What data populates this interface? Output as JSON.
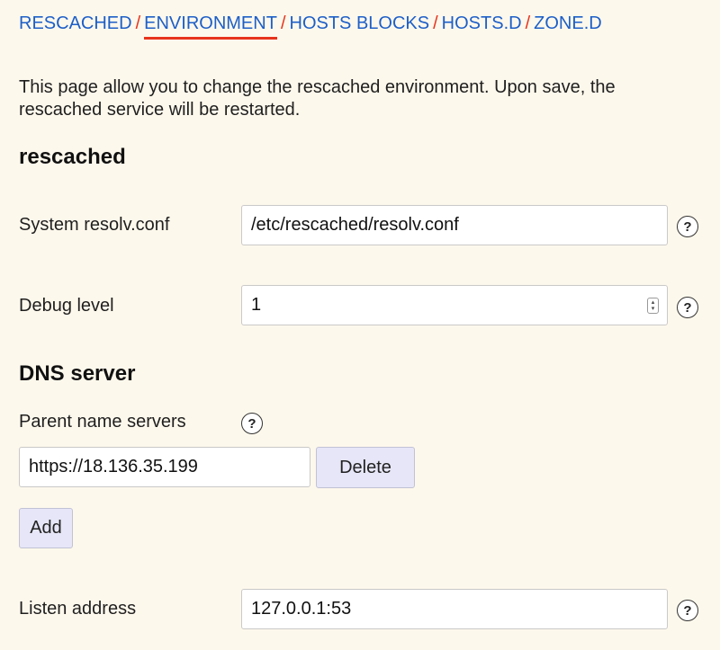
{
  "nav": {
    "items": [
      {
        "label": "RESCACHED"
      },
      {
        "label": "ENVIRONMENT"
      },
      {
        "label": "HOSTS BLOCKS"
      },
      {
        "label": "HOSTS.D"
      },
      {
        "label": "ZONE.D"
      }
    ],
    "separator": "/"
  },
  "intro": "This page allow you to change the rescached environment. Upon save, the rescached service will be restarted.",
  "sections": {
    "rescached": {
      "title": "rescached",
      "system_resolv": {
        "label": "System resolv.conf",
        "value": "/etc/rescached/resolv.conf"
      },
      "debug_level": {
        "label": "Debug level",
        "value": "1"
      }
    },
    "dns_server": {
      "title": "DNS server",
      "parent_name_servers": {
        "label": "Parent name servers",
        "servers": [
          {
            "value": "https://18.136.35.199"
          }
        ],
        "delete_label": "Delete",
        "add_label": "Add"
      },
      "listen_address": {
        "label": "Listen address",
        "value": "127.0.0.1:53"
      }
    }
  },
  "help_glyph": "?",
  "stepper_glyphs": {
    "up": "▴",
    "down": "▾"
  }
}
